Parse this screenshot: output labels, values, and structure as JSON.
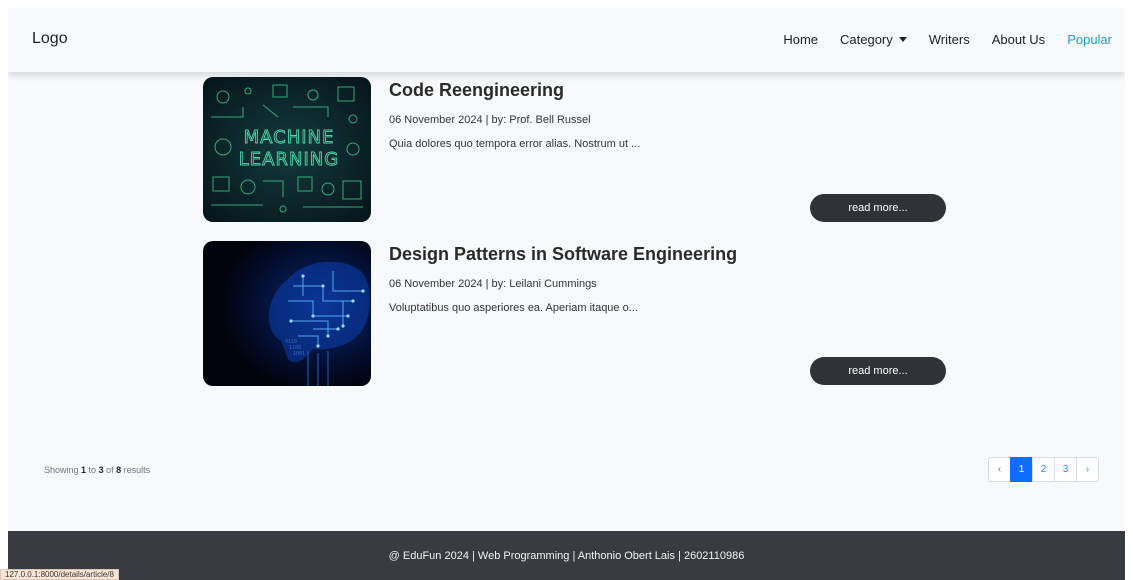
{
  "navbar": {
    "logo": "Logo",
    "links": {
      "home": "Home",
      "category": "Category",
      "writers": "Writers",
      "about": "About Us",
      "popular": "Popular"
    },
    "active_color": "#2596be"
  },
  "articles": [
    {
      "title": "Code Reengineering",
      "meta": "06 November 2024 | by: Prof. Bell Russel",
      "excerpt": "Quia dolores quo tempora error alias. Nostrum ut ...",
      "read_more": "read more...",
      "image": {
        "top_line": "MACHINE",
        "bottom_line": "LEARNING"
      }
    },
    {
      "title": "Design Patterns in Software Engineering",
      "meta": "06 November 2024 | by: Leilani Cummings",
      "excerpt": "Voluptatibus quo asperiores ea. Aperiam itaque o...",
      "read_more": "read more...",
      "image": {
        "digits_1": "0110",
        "digits_2": "1100",
        "digits_3": "1001"
      }
    }
  ],
  "pagination": {
    "showing_prefix": "Showing ",
    "from": "1",
    "to_word": " to ",
    "to": "3",
    "of_word": " of ",
    "total": "8",
    "suffix": " results",
    "prev": "‹",
    "pages": [
      "1",
      "2",
      "3"
    ],
    "next": "›",
    "current_color": "#0d6efd"
  },
  "footer": {
    "text": "@ EduFun 2024 | Web Programming | Anthonio Obert Lais | 2602110986"
  },
  "status_bar": {
    "url": "127.0.0.1:8000/details/article/8"
  }
}
